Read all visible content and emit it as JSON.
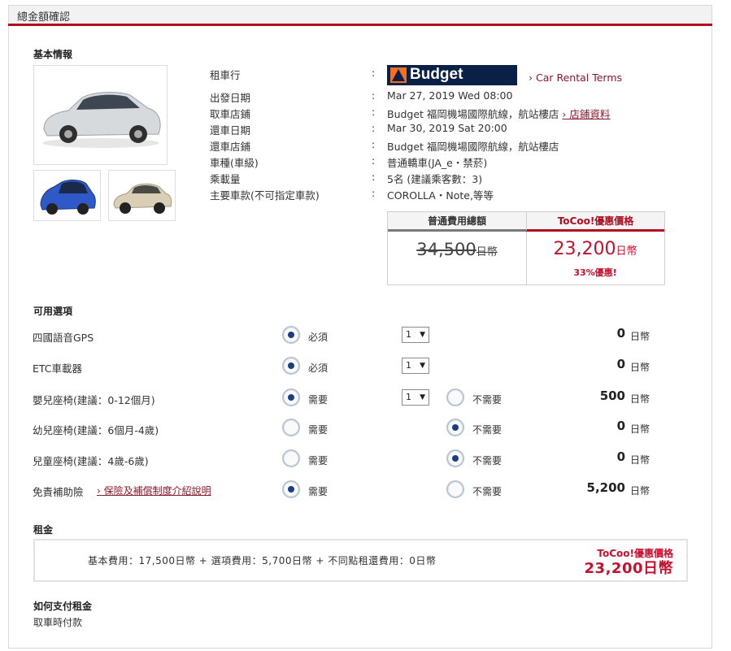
{
  "page": {
    "header_title": "總金額確認"
  },
  "basic": {
    "section_title": "基本情報",
    "rows": [
      {
        "label": "租車行",
        "value": ""
      },
      {
        "label": "出發日期",
        "value": "Mar 27, 2019 Wed 08:00"
      },
      {
        "label": "取車店鋪",
        "value": "Budget 福岡機場國際航線，航站樓店"
      },
      {
        "label": "還車日期",
        "value": "Mar 30, 2019 Sat 20:00"
      },
      {
        "label": "還車店鋪",
        "value": "Budget 福岡機場國際航線，航站樓店"
      },
      {
        "label": "車種(車級)",
        "value": "普通轎車(JA_e・禁菸)"
      },
      {
        "label": "乘載量",
        "value": "5名 (建議乘客數：3)"
      },
      {
        "label": "主要車款(不可指定車款)",
        "value": "COROLLA・Note,等等"
      }
    ],
    "colon": ":",
    "brand_logo_text": "Budget",
    "terms_link": "› Car Rental Terms",
    "store_link": "› 店鋪資料"
  },
  "price": {
    "normal_label": "普通費用總額",
    "tocoo_label": "ToCoo!優惠價格",
    "normal_amount": "34,500",
    "tocoo_amount": "23,200",
    "currency": "日幣",
    "discount": "33%優惠!"
  },
  "options": {
    "section_title": "可用選項",
    "items": [
      {
        "label": "四國語音GPS",
        "choice1": "必須",
        "choice1_selected": true,
        "qty": "1",
        "choice2": "",
        "amount": "0",
        "unit": "日幣"
      },
      {
        "label": "ETC車載器",
        "choice1": "必須",
        "choice1_selected": true,
        "qty": "1",
        "choice2": "",
        "amount": "0",
        "unit": "日幣"
      },
      {
        "label": "嬰兒座椅(建議：0-12個月)",
        "choice1": "需要",
        "choice1_selected": true,
        "qty": "1",
        "choice2": "不需要",
        "amount": "500",
        "unit": "日幣"
      },
      {
        "label": "幼兒座椅(建議：6個月-4歲)",
        "choice1": "需要",
        "choice1_selected": false,
        "qty": "",
        "choice2": "不需要",
        "amount": "0",
        "unit": "日幣"
      },
      {
        "label": "兒童座椅(建議：4歲-6歲)",
        "choice1": "需要",
        "choice1_selected": false,
        "qty": "",
        "choice2": "不需要",
        "amount": "0",
        "unit": "日幣"
      },
      {
        "label": "免責補助險",
        "link": "› 保險及補償制度介紹說明",
        "choice1": "需要",
        "choice1_selected": true,
        "qty": "",
        "choice2": "不需要",
        "amount": "5,200",
        "unit": "日幣"
      }
    ]
  },
  "rent": {
    "section_title": "租金",
    "detail": "基本費用：17,500日幣 + 選項費用：5,700日幣 + 不同點租還費用：0日幣",
    "promo_label": "ToCoo!優惠價格",
    "total": "23,200日幣"
  },
  "payment": {
    "section_title": "如何支付租金",
    "method": "取車時付款"
  },
  "colors": {
    "accent": "#b00d1f",
    "price_red": "#c8102e",
    "link": "#8b1a2b",
    "logo_bg": "#0b2046"
  }
}
